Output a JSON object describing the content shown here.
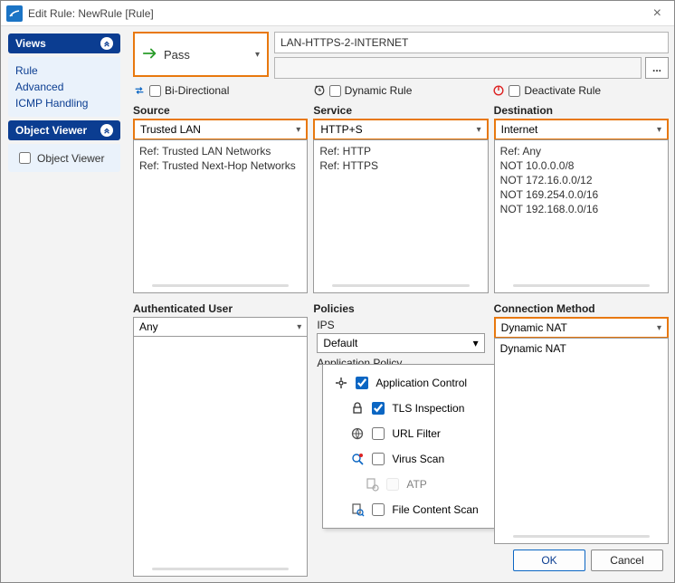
{
  "window": {
    "title": "Edit Rule: NewRule [Rule]"
  },
  "sidebar": {
    "views_header": "Views",
    "views": [
      "Rule",
      "Advanced",
      "ICMP Handling"
    ],
    "viewer_header": "Object Viewer",
    "viewer_checkbox": "Object Viewer"
  },
  "action": {
    "label": "Pass"
  },
  "rule_name": "LAN-HTTPS-2-INTERNET",
  "options": {
    "bidi": "Bi-Directional",
    "dynamic": "Dynamic Rule",
    "deactivate": "Deactivate Rule"
  },
  "source": {
    "header": "Source",
    "selected": "Trusted LAN",
    "items": [
      "Ref: Trusted LAN Networks",
      "Ref: Trusted Next-Hop Networks"
    ]
  },
  "service": {
    "header": "Service",
    "selected": "HTTP+S",
    "items": [
      "Ref: HTTP",
      "Ref: HTTPS"
    ]
  },
  "destination": {
    "header": "Destination",
    "selected": "Internet",
    "items": [
      "Ref: Any",
      "NOT 10.0.0.0/8",
      "NOT 172.16.0.0/12",
      "NOT 169.254.0.0/16",
      "NOT 192.168.0.0/16"
    ]
  },
  "auth_user": {
    "header": "Authenticated User",
    "selected": "Any"
  },
  "policies": {
    "header": "Policies",
    "ips_label": "IPS",
    "ips_value": "Default",
    "app_policy_label": "Application Policy",
    "items": {
      "app_control": {
        "label": "Application Control",
        "checked": true
      },
      "tls": {
        "label": "TLS Inspection",
        "checked": true
      },
      "url": {
        "label": "URL Filter",
        "checked": false
      },
      "virus": {
        "label": "Virus Scan",
        "checked": false
      },
      "atp": {
        "label": "ATP",
        "checked": false,
        "disabled": true
      },
      "file": {
        "label": "File Content Scan",
        "checked": false
      }
    }
  },
  "conn": {
    "header": "Connection Method",
    "selected": "Dynamic NAT",
    "items": [
      "Dynamic NAT"
    ]
  },
  "buttons": {
    "ok": "OK",
    "cancel": "Cancel"
  }
}
